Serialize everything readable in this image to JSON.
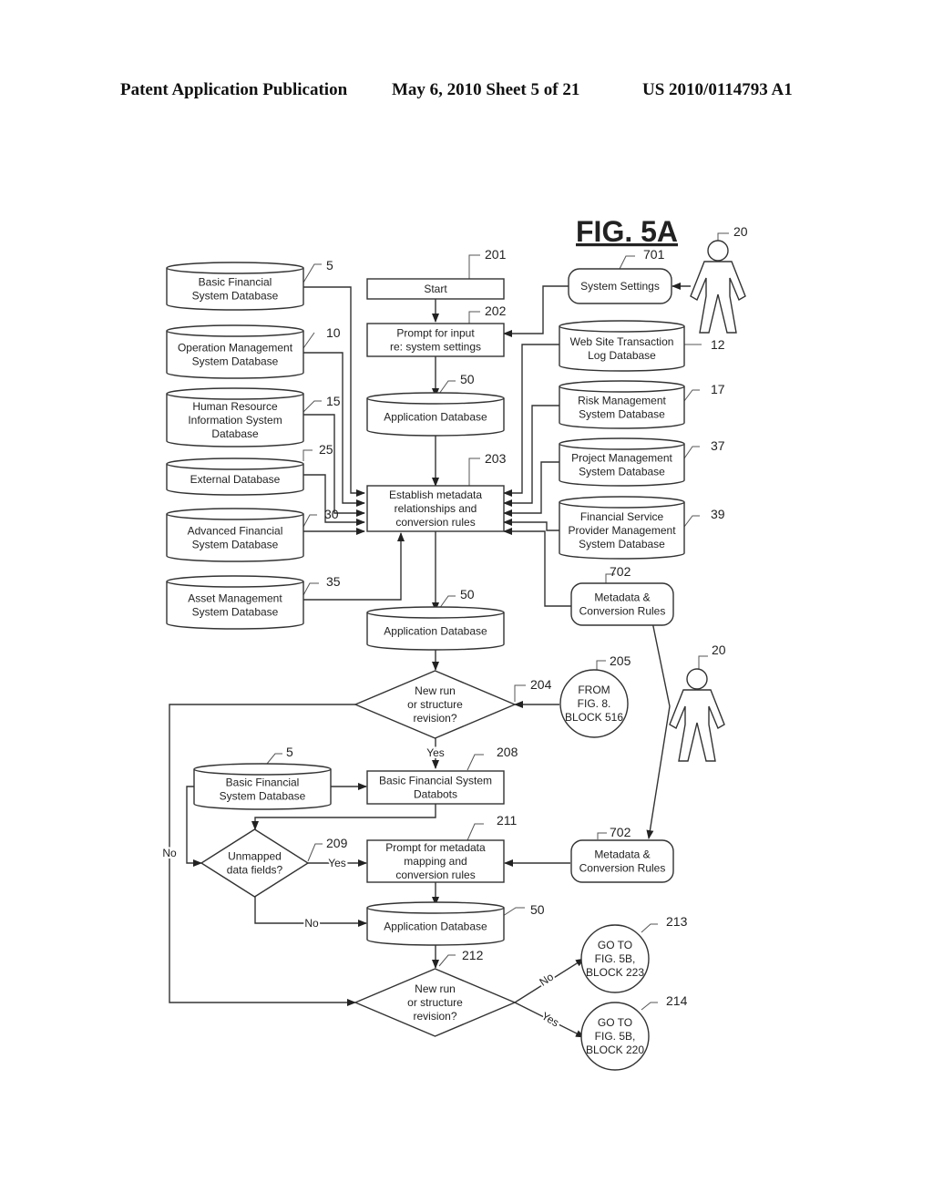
{
  "header": {
    "publication": "Patent Application Publication",
    "date_sheet": "May 6, 2010   Sheet 5 of 21",
    "number": "US 2010/0114793 A1"
  },
  "figure": {
    "title": "FIG. 5A"
  },
  "nodes": {
    "db_basic_fin": {
      "lines": [
        "Basic Financial",
        "System Database"
      ],
      "ref": "5"
    },
    "db_operation": {
      "lines": [
        "Operation Management",
        "System Database"
      ],
      "ref": "10"
    },
    "db_hris": {
      "lines": [
        "Human Resource",
        "Information System",
        "Database"
      ],
      "ref": "15"
    },
    "db_external": {
      "lines": [
        "External Database"
      ],
      "ref": "25"
    },
    "db_adv_fin": {
      "lines": [
        "Advanced Financial",
        "System Database"
      ],
      "ref": "30"
    },
    "db_asset": {
      "lines": [
        "Asset Management",
        "System Database"
      ],
      "ref": "35"
    },
    "start": {
      "lines": [
        "Start"
      ],
      "ref": "201"
    },
    "prompt_input": {
      "lines": [
        "Prompt for input",
        "re: system settings"
      ],
      "ref": "202"
    },
    "app_db_1": {
      "lines": [
        "Application Database"
      ],
      "ref": "50"
    },
    "establish": {
      "lines": [
        "Establish metadata",
        "relationships and",
        "conversion rules"
      ],
      "ref": "203"
    },
    "app_db_2": {
      "lines": [
        "Application Database"
      ],
      "ref": "50"
    },
    "decision_204": {
      "lines": [
        "New run",
        "or structure",
        "revision?"
      ],
      "ref": "204"
    },
    "system_settings": {
      "lines": [
        "System Settings"
      ],
      "ref": "701"
    },
    "user_top": {
      "ref": "20"
    },
    "db_web_log": {
      "lines": [
        "Web Site Transaction",
        "Log Database"
      ],
      "ref": "12"
    },
    "db_risk": {
      "lines": [
        "Risk Management",
        "System Database"
      ],
      "ref": "17"
    },
    "db_project": {
      "lines": [
        "Project Management",
        "System Database"
      ],
      "ref": "37"
    },
    "db_fsp": {
      "lines": [
        "Financial Service",
        "Provider Management",
        "System Database"
      ],
      "ref": "39"
    },
    "metadata_rules_1": {
      "lines": [
        "Metadata &",
        "Conversion Rules"
      ],
      "ref": "702"
    },
    "connector_205": {
      "lines": [
        "FROM",
        "FIG. 8.",
        "BLOCK 516"
      ],
      "ref": "205"
    },
    "user_mid": {
      "ref": "20"
    },
    "db_basic_fin_2": {
      "lines": [
        "Basic Financial",
        "System Database"
      ],
      "ref": "5"
    },
    "databots": {
      "lines": [
        "Basic Financial System",
        "Databots"
      ],
      "ref": "208"
    },
    "decision_209": {
      "lines": [
        "Unmapped",
        "data fields?"
      ],
      "ref": "209"
    },
    "prompt_metadata": {
      "lines": [
        "Prompt for metadata",
        "mapping and",
        "conversion rules"
      ],
      "ref": "211"
    },
    "metadata_rules_2": {
      "lines": [
        "Metadata &",
        "Conversion Rules"
      ],
      "ref": "702"
    },
    "app_db_3": {
      "lines": [
        "Application Database"
      ],
      "ref": "50"
    },
    "decision_212": {
      "lines": [
        "New run",
        "or structure",
        "revision?"
      ],
      "ref": "212"
    },
    "connector_213": {
      "lines": [
        "GO TO",
        "FIG. 5B,",
        "BLOCK 223"
      ],
      "ref": "213"
    },
    "connector_214": {
      "lines": [
        "GO TO",
        "FIG. 5B,",
        "BLOCK 220"
      ],
      "ref": "214"
    }
  },
  "edge_labels": {
    "yes_204": "Yes",
    "no_204": "No",
    "yes_209": "Yes",
    "no_209": "No",
    "no_212": "No",
    "yes_212": "Yes"
  }
}
